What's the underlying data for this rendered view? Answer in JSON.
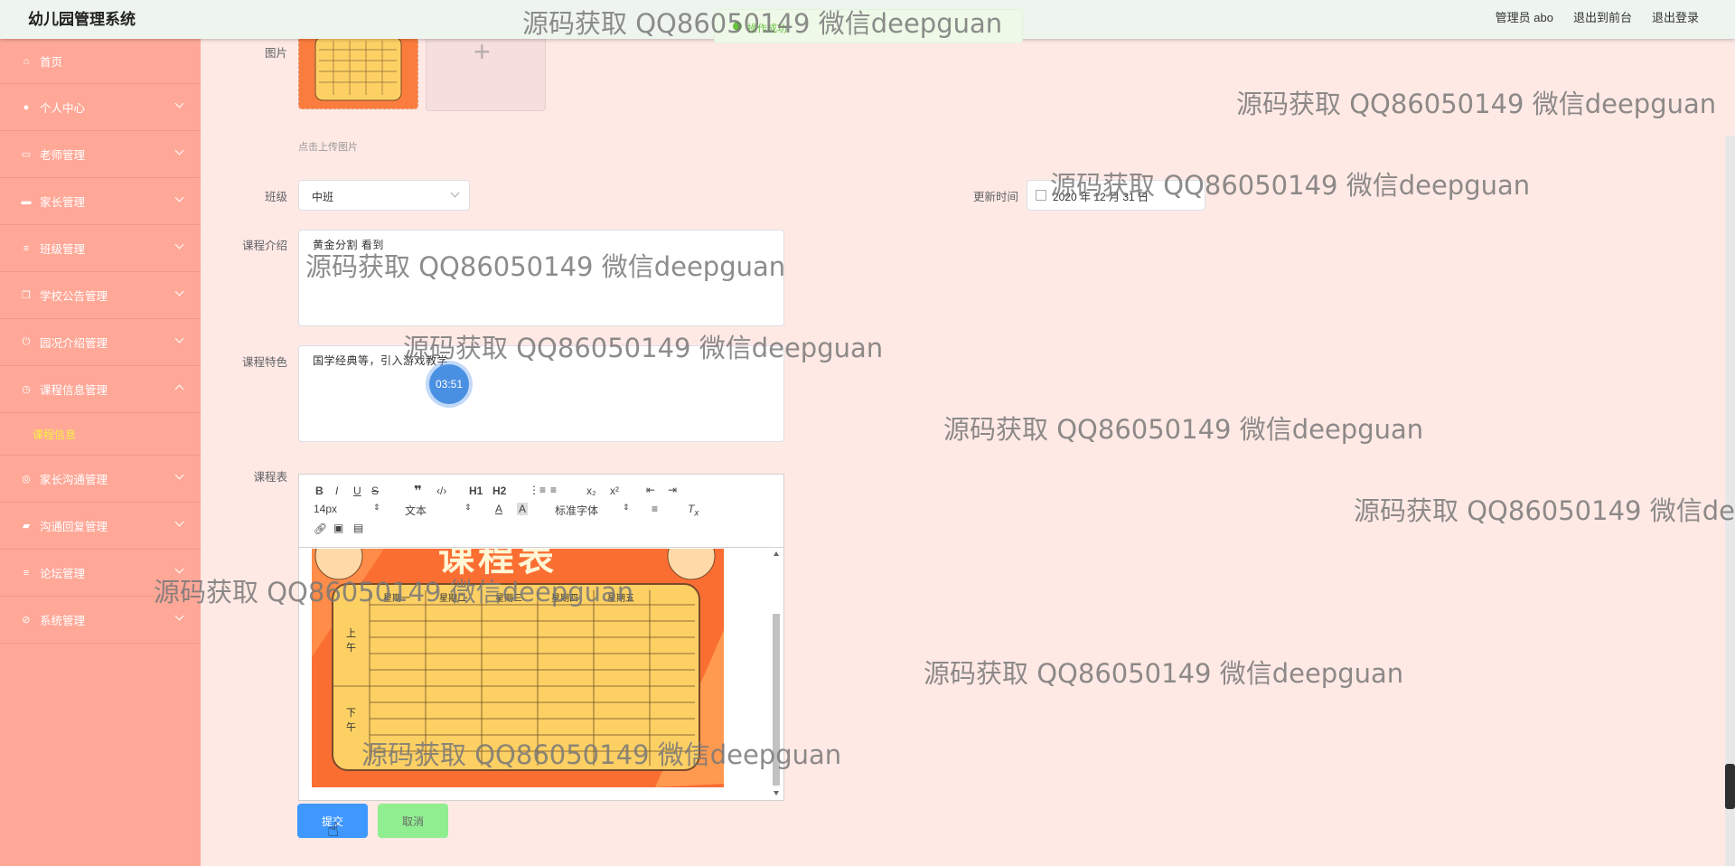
{
  "header": {
    "title": "幼儿园管理系统",
    "user": "管理员 abo",
    "front": "退出到前台",
    "logout": "退出登录"
  },
  "toast": "操作成功",
  "sidebar": {
    "items": [
      {
        "label": "首页",
        "icon": "home-icon",
        "expanded": null
      },
      {
        "label": "个人中心",
        "icon": "user-icon",
        "expanded": false
      },
      {
        "label": "老师管理",
        "icon": "chat-icon",
        "expanded": false
      },
      {
        "label": "家长管理",
        "icon": "monitor-icon",
        "expanded": false
      },
      {
        "label": "班级管理",
        "icon": "list-icon",
        "expanded": false
      },
      {
        "label": "学校公告管理",
        "icon": "copy-icon",
        "expanded": false
      },
      {
        "label": "园况介绍管理",
        "icon": "power-icon",
        "expanded": false
      },
      {
        "label": "课程信息管理",
        "icon": "clock-icon",
        "expanded": true
      },
      {
        "label": "家长沟通管理",
        "icon": "target-icon",
        "expanded": false
      },
      {
        "label": "沟通回复管理",
        "icon": "briefcase-icon",
        "expanded": false
      },
      {
        "label": "论坛管理",
        "icon": "list-icon",
        "expanded": false
      },
      {
        "label": "系统管理",
        "icon": "no-bell-icon",
        "expanded": false
      }
    ],
    "submenu": "课程信息"
  },
  "form": {
    "image_label": "图片",
    "upload_hint": "点击上传图片",
    "class_label": "班级",
    "class_value": "中班",
    "update_label": "更新时间",
    "update_value": "2020 年 12 月 31 日",
    "intro_label": "课程介绍",
    "intro_value": "黄金分割  看到",
    "feature_label": "课程特色",
    "feature_value": "国学经典等，引入游戏教学",
    "schedule_label": "课程表"
  },
  "toolbar": {
    "font_size": "14px",
    "paragraph": "文本",
    "font_family": "标准字体",
    "h1": "H1",
    "h2": "H2"
  },
  "poster": {
    "title": "课程表",
    "days": [
      "星期一",
      "星期二",
      "星期三",
      "星期四",
      "星期五"
    ],
    "am": "上午",
    "pm": "下午"
  },
  "buttons": {
    "submit": "提交",
    "cancel": "取消"
  },
  "timer": "03:51",
  "watermark": "源码获取 QQ86050149 微信deepguan"
}
